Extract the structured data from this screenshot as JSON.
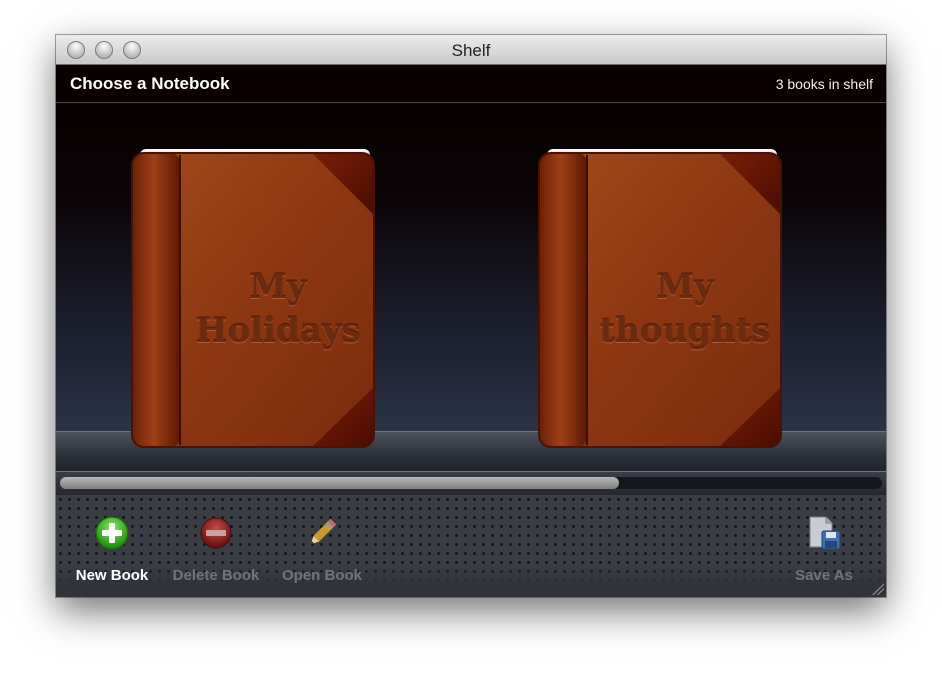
{
  "window": {
    "title": "Shelf"
  },
  "header": {
    "title": "Choose a Notebook",
    "count_text": "3 books in shelf"
  },
  "books": [
    {
      "title_line1": "My",
      "title_line2": "Holidays"
    },
    {
      "title_line1": "My",
      "title_line2": "thoughts"
    }
  ],
  "scroll": {
    "visible_fraction": 0.68,
    "position": 0
  },
  "toolbar": {
    "new_book": {
      "label": "New Book",
      "icon": "plus-circle-icon",
      "enabled": true
    },
    "delete_book": {
      "label": "Delete Book",
      "icon": "minus-circle-icon",
      "enabled": false
    },
    "open_book": {
      "label": "Open Book",
      "icon": "pencil-icon",
      "enabled": false
    },
    "save_as": {
      "label": "Save As",
      "icon": "save-document-icon",
      "enabled": false
    }
  },
  "colors": {
    "accent_green": "#3cbf1e",
    "leather": "#9a3f16",
    "disabled_text": "#6f747e"
  }
}
